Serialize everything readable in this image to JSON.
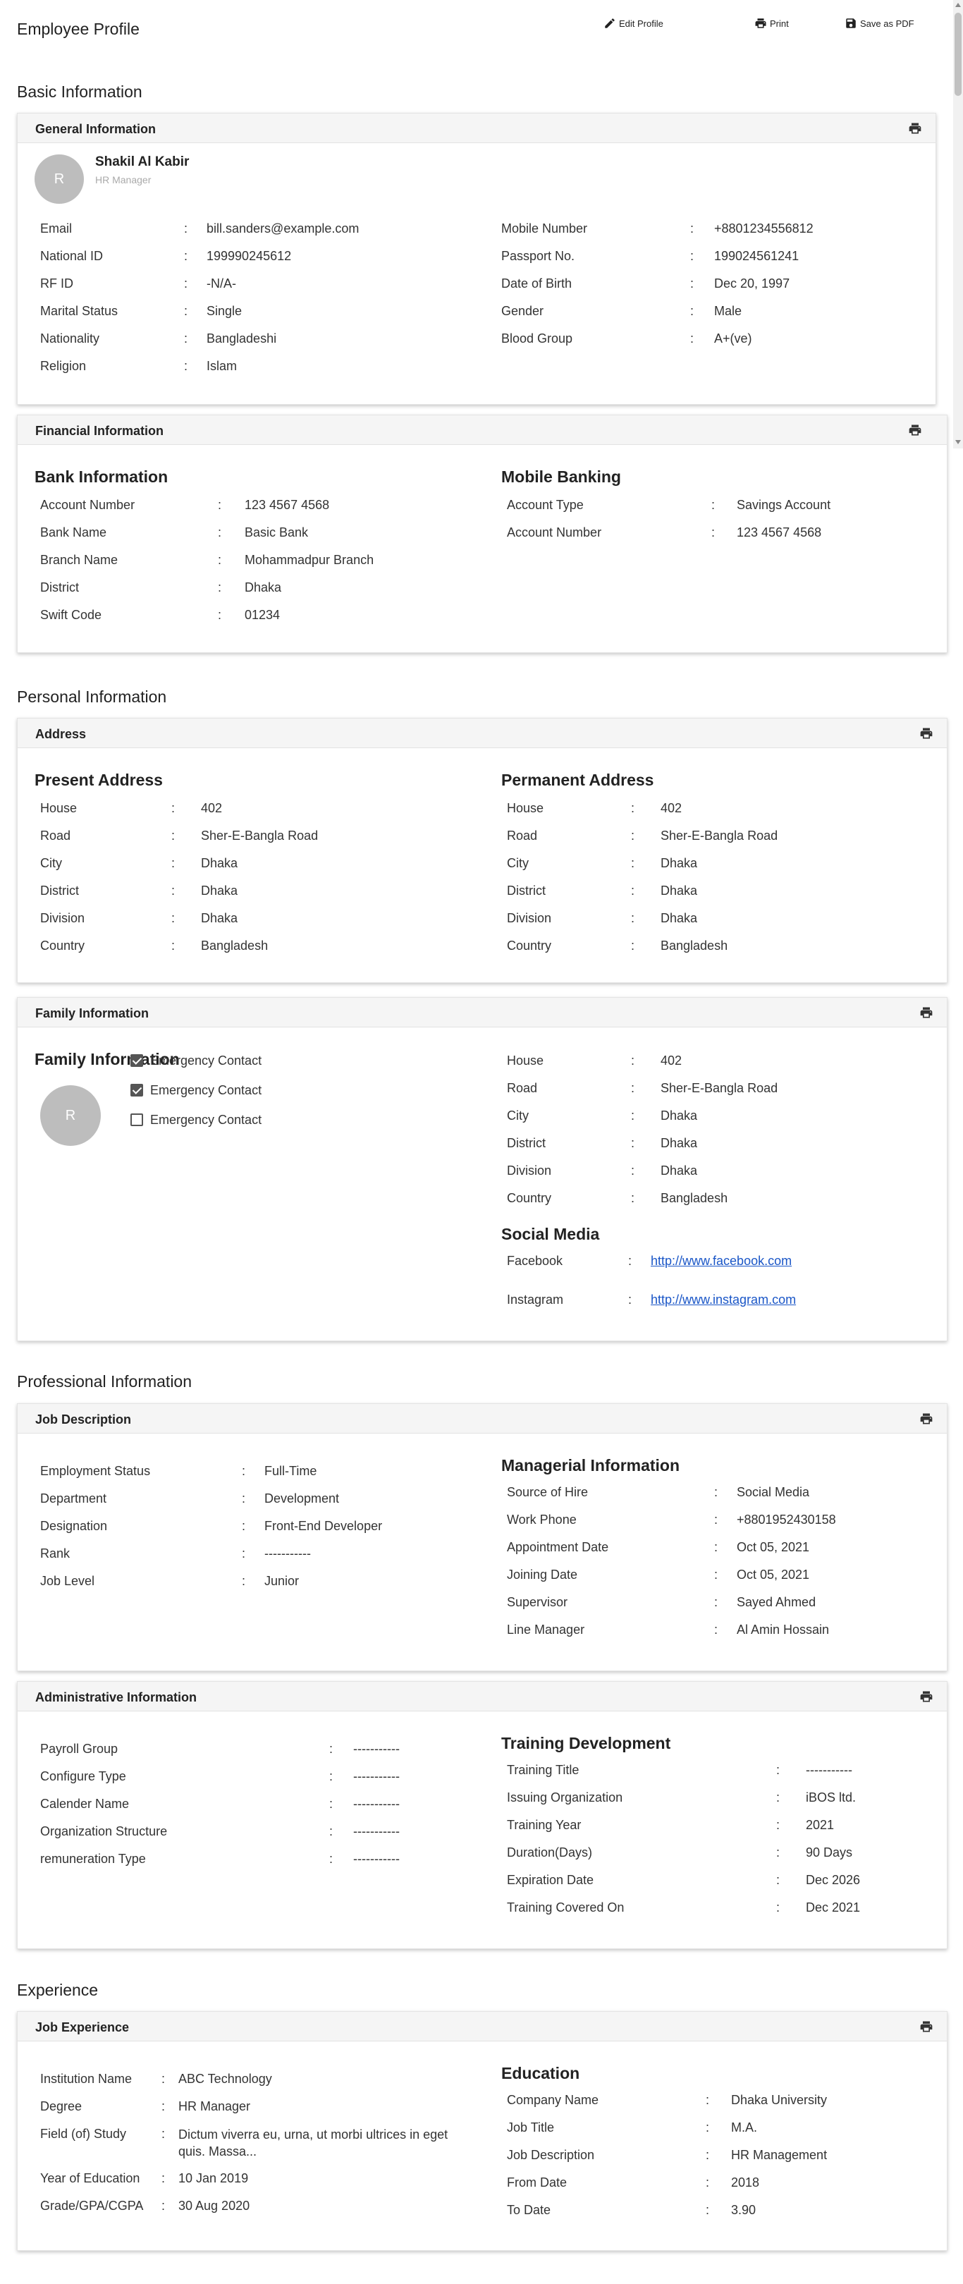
{
  "page": {
    "title": "Employee Profile",
    "actions": {
      "edit": "Edit Profile",
      "print": "Print",
      "save_pdf": "Save as PDF"
    }
  },
  "basic": {
    "title": "Basic Information",
    "general": {
      "title": "General Information",
      "avatar_initial": "R",
      "name": "Shakil Al Kabir",
      "role": "HR Manager",
      "left": [
        {
          "label": "Email",
          "value": "bill.sanders@example.com"
        },
        {
          "label": "National ID",
          "value": "199990245612"
        },
        {
          "label": "RF ID",
          "value": "-N/A-"
        },
        {
          "label": "Marital Status",
          "value": "Single"
        },
        {
          "label": "Nationality",
          "value": "Bangladeshi"
        },
        {
          "label": "Religion",
          "value": "Islam"
        }
      ],
      "right": [
        {
          "label": "Mobile Number",
          "value": "+8801234556812"
        },
        {
          "label": "Passport No.",
          "value": "199024561241"
        },
        {
          "label": "Date of Birth",
          "value": "Dec 20, 1997"
        },
        {
          "label": "Gender",
          "value": "Male"
        },
        {
          "label": "Blood Group",
          "value": "A+(ve)"
        }
      ]
    },
    "financial": {
      "title": "Financial Information",
      "bank_title": "Bank Information",
      "bank": [
        {
          "label": "Account Number",
          "value": "123 4567 4568"
        },
        {
          "label": "Bank Name",
          "value": "Basic Bank"
        },
        {
          "label": "Branch Name",
          "value": "Mohammadpur Branch"
        },
        {
          "label": "District",
          "value": "Dhaka"
        },
        {
          "label": "Swift Code",
          "value": "01234"
        }
      ],
      "mobile_title": "Mobile Banking",
      "mobile": [
        {
          "label": "Account Type",
          "value": "Savings Account"
        },
        {
          "label": "Account Number",
          "value": "123 4567 4568"
        }
      ]
    }
  },
  "personal": {
    "title": "Personal Information",
    "address": {
      "title": "Address",
      "present_title": "Present Address",
      "present": [
        {
          "label": "House",
          "value": "402"
        },
        {
          "label": "Road",
          "value": "Sher-E-Bangla Road"
        },
        {
          "label": "City",
          "value": "Dhaka"
        },
        {
          "label": "District",
          "value": "Dhaka"
        },
        {
          "label": "Division",
          "value": "Dhaka"
        },
        {
          "label": "Country",
          "value": "Bangladesh"
        }
      ],
      "permanent_title": "Permanent Address",
      "permanent": [
        {
          "label": "House",
          "value": "402"
        },
        {
          "label": "Road",
          "value": "Sher-E-Bangla Road"
        },
        {
          "label": "City",
          "value": "Dhaka"
        },
        {
          "label": "District",
          "value": "Dhaka"
        },
        {
          "label": "Division",
          "value": "Dhaka"
        },
        {
          "label": "Country",
          "value": "Bangladesh"
        }
      ]
    },
    "family": {
      "title": "Family Information",
      "sub_title": "Family Information",
      "avatar_initial": "R",
      "contacts": [
        {
          "label": "Emergency Contact",
          "checked": true
        },
        {
          "label": "Emergency Contact",
          "checked": true
        },
        {
          "label": "Emergency Contact",
          "checked": false
        }
      ],
      "address": [
        {
          "label": "House",
          "value": "402"
        },
        {
          "label": "Road",
          "value": "Sher-E-Bangla Road"
        },
        {
          "label": "City",
          "value": "Dhaka"
        },
        {
          "label": "District",
          "value": "Dhaka"
        },
        {
          "label": "Division",
          "value": "Dhaka"
        },
        {
          "label": "Country",
          "value": "Bangladesh"
        }
      ],
      "social_title": "Social Media",
      "social": [
        {
          "label": "Facebook",
          "value": "http://www.facebook.com"
        },
        {
          "label": "Instagram",
          "value": "http://www.instagram.com"
        }
      ]
    }
  },
  "professional": {
    "title": "Professional Information",
    "job": {
      "title": "Job Description",
      "left": [
        {
          "label": "Employment Status",
          "value": "Full-Time"
        },
        {
          "label": "Department",
          "value": "Development"
        },
        {
          "label": "Designation",
          "value": "Front-End Developer"
        },
        {
          "label": "Rank",
          "value": "-----------"
        },
        {
          "label": "Job Level",
          "value": "Junior"
        }
      ],
      "managerial_title": "Managerial Information",
      "managerial": [
        {
          "label": "Source of Hire",
          "value": "Social Media"
        },
        {
          "label": "Work Phone",
          "value": "+8801952430158"
        },
        {
          "label": "Appointment Date",
          "value": "Oct 05, 2021"
        },
        {
          "label": "Joining Date",
          "value": "Oct 05, 2021"
        },
        {
          "label": "Supervisor",
          "value": "Sayed Ahmed"
        },
        {
          "label": "Line Manager",
          "value": "Al Amin Hossain"
        }
      ]
    },
    "admin": {
      "title": "Administrative Information",
      "left": [
        {
          "label": "Payroll Group",
          "value": "-----------"
        },
        {
          "label": "Configure Type",
          "value": "-----------"
        },
        {
          "label": "Calender Name",
          "value": "-----------"
        },
        {
          "label": "Organization Structure",
          "value": "-----------"
        },
        {
          "label": "remuneration Type",
          "value": "-----------"
        }
      ],
      "training_title": "Training Development",
      "training": [
        {
          "label": "Training Title",
          "value": "-----------"
        },
        {
          "label": "Issuing Organization",
          "value": "iBOS ltd."
        },
        {
          "label": "Training Year",
          "value": "2021"
        },
        {
          "label": "Duration(Days)",
          "value": "90 Days"
        },
        {
          "label": "Expiration Date",
          "value": "Dec 2026"
        },
        {
          "label": "Training Covered On",
          "value": "Dec 2021"
        }
      ]
    }
  },
  "experience": {
    "title": "Experience",
    "job": {
      "title": "Job Experience",
      "left": [
        {
          "label": "Institution Name",
          "value": "ABC Technology"
        },
        {
          "label": "Degree",
          "value": "HR Manager"
        },
        {
          "label": "Field (of) Study",
          "value": "Dictum viverra eu, urna, ut morbi ultrices in eget quis. Massa..."
        },
        {
          "label": "Year of Education",
          "value": "10 Jan 2019"
        },
        {
          "label": "Grade/GPA/CGPA",
          "value": "30 Aug 2020"
        }
      ],
      "education_title": "Education",
      "education": [
        {
          "label": "Company Name",
          "value": "Dhaka University"
        },
        {
          "label": "Job Title",
          "value": "M.A."
        },
        {
          "label": "Job Description",
          "value": "HR Management"
        },
        {
          "label": "From Date",
          "value": "2018"
        },
        {
          "label": "To Date",
          "value": "3.90"
        }
      ]
    }
  }
}
